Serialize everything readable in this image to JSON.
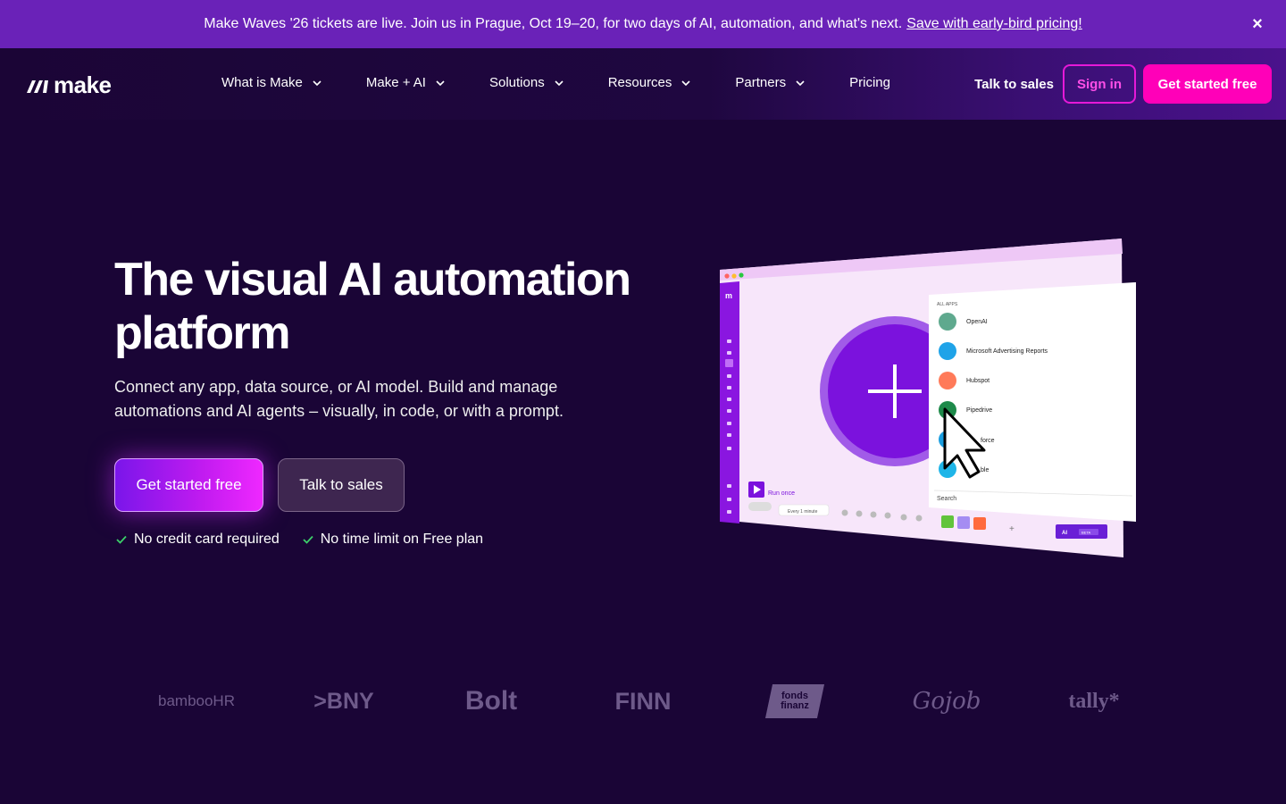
{
  "banner": {
    "text": "Make Waves '26 tickets are live. Join us in Prague, Oct 19–20, for two days of AI, automation, and what's next.",
    "link": "Save with early-bird pricing!",
    "close_icon": "×"
  },
  "nav": {
    "logo": "make",
    "items": [
      {
        "label": "What is Make",
        "dropdown": true
      },
      {
        "label": "Make + AI",
        "dropdown": true
      },
      {
        "label": "Solutions",
        "dropdown": true
      },
      {
        "label": "Resources",
        "dropdown": true
      },
      {
        "label": "Partners",
        "dropdown": true
      },
      {
        "label": "Pricing",
        "dropdown": false
      }
    ],
    "talk_to_sales": "Talk to sales",
    "sign_in": "Sign in",
    "get_started": "Get started free"
  },
  "hero": {
    "title": "The visual AI automation platform",
    "subtitle": "Connect any app, data source, or AI model. Build and manage automations and AI agents – visually, in code, or with a prompt.",
    "primary_button": "Get started free",
    "secondary_button": "Talk to sales",
    "checks": [
      "No credit card required",
      "No time limit on Free plan"
    ]
  },
  "mockup": {
    "panel_heading": "ALL APPS",
    "apps": [
      {
        "name": "OpenAI",
        "color": "#5fa98e"
      },
      {
        "name": "Microsoft Advertising Reports",
        "color": "#1fa3e8"
      },
      {
        "name": "Hubspot",
        "color": "#ff7a59"
      },
      {
        "name": "Pipedrive",
        "color": "#1e8a4a"
      },
      {
        "name": "force",
        "color": "#1a9ee0"
      },
      {
        "name": "ble",
        "color": "#1fb5e8"
      }
    ],
    "search_label": "Search",
    "run_once": "Run once",
    "schedule": "Every 1 minute",
    "ai_button": "AI",
    "beta": "BETA"
  },
  "logos": [
    "bambooHR",
    "BNY",
    "Bolt",
    "FINN",
    "fonds finanz",
    "Gojob",
    "tally*"
  ],
  "colors": {
    "background": "#1a0536",
    "banner": "#6a22b8",
    "accent_pink": "#ff00b8",
    "accent_purple": "#7a16ea"
  }
}
